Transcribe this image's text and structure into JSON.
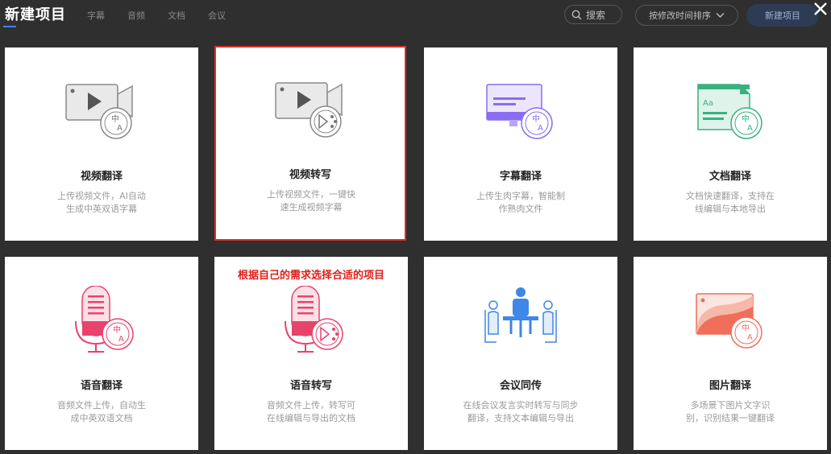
{
  "header": {
    "title": "新建项目",
    "tabs": [
      "字幕",
      "音频",
      "文档",
      "会议"
    ],
    "search_label": "搜索",
    "sort_label": "按修改时间排序",
    "new_button": "新建项目"
  },
  "annotation": "根据自己的需求选择合适的项目",
  "cards": [
    {
      "name": "视频翻译",
      "desc1": "上传视频文件，AI自动",
      "desc2": "生成中英双语字幕"
    },
    {
      "name": "视频转写",
      "desc1": "上传视频文件，一键快",
      "desc2": "速生成视频字幕"
    },
    {
      "name": "字幕翻译",
      "desc1": "上传生肉字幕，智能制",
      "desc2": "作熟肉文件"
    },
    {
      "name": "文档翻译",
      "desc1": "文档快速翻译，支持在",
      "desc2": "线编辑与本地导出"
    },
    {
      "name": "语音翻译",
      "desc1": "音频文件上传，自动生",
      "desc2": "成中英双语文档"
    },
    {
      "name": "语音转写",
      "desc1": "音频文件上传，转写可",
      "desc2": "在线编辑与导出的文档"
    },
    {
      "name": "会议同传",
      "desc1": "在线会议发言实时转写与同步",
      "desc2": "翻译，支持文本编辑与导出"
    },
    {
      "name": "图片翻译",
      "desc1": "多场景下图片文字识",
      "desc2": "别，识别结果一键翻译"
    }
  ],
  "icon_glyphs": {
    "zh": "中",
    "en": "A",
    "doc": "Aa"
  },
  "colors": {
    "background": "#2f2f2f",
    "selected_border": "#d9302a",
    "annotation": "#e0201a",
    "video_gray": "#8a8a8a",
    "purple": "#8b6cf0",
    "green": "#37b27f",
    "pink": "#e8436b",
    "blue": "#3e86e8",
    "coral": "#ef6f5a"
  }
}
